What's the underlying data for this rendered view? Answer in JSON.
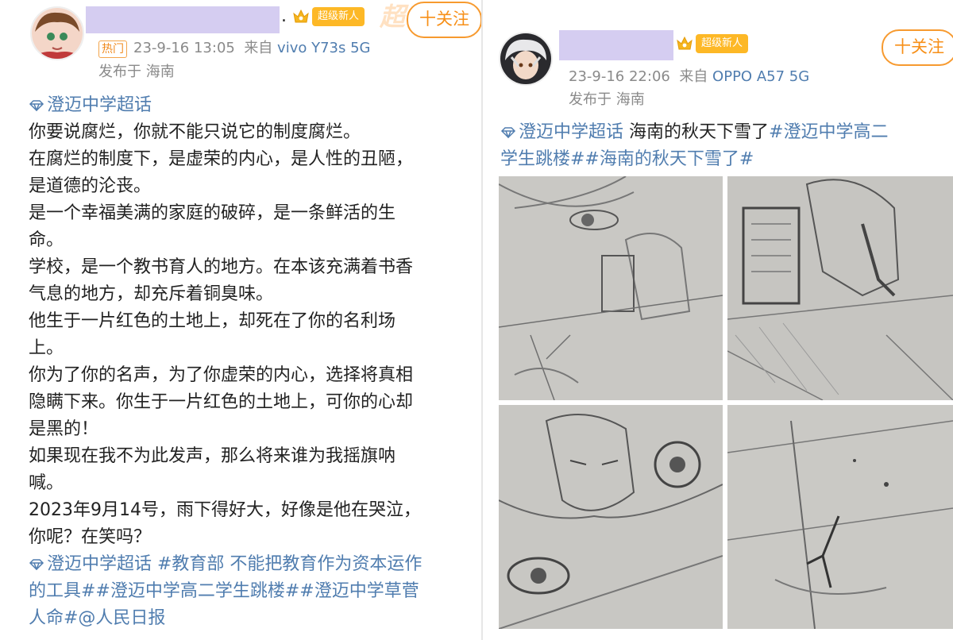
{
  "left_post": {
    "badge": "超级新人",
    "follow_label": "十关注",
    "faded_text": "超",
    "dot": ".",
    "hot_tag": "热门",
    "time": "23-9-16 13:05",
    "source_prefix": "来自",
    "device": "vivo Y73s 5G",
    "location": "发布于 海南",
    "lines": [
      {
        "type": "topic",
        "text": "澄迈中学超话"
      },
      {
        "type": "text",
        "text": "你要说腐烂，你就不能只说它的制度腐烂。"
      },
      {
        "type": "text",
        "text": "在腐烂的制度下，是虚荣的内心，是人性的丑陋，"
      },
      {
        "type": "text",
        "text": "是道德的沦丧。"
      },
      {
        "type": "text",
        "text": "是一个幸福美满的家庭的破碎，是一条鲜活的生"
      },
      {
        "type": "text",
        "text": "命。"
      },
      {
        "type": "text",
        "text": "学校，是一个教书育人的地方。在本该充满着书香"
      },
      {
        "type": "text",
        "text": "气息的地方，却充斥着铜臭味。"
      },
      {
        "type": "text",
        "text": "他生于一片红色的土地上，却死在了你的名利场"
      },
      {
        "type": "text",
        "text": "上。"
      },
      {
        "type": "text",
        "text": "你为了你的名声，为了你虚荣的内心，选择将真相"
      },
      {
        "type": "text",
        "text": "隐瞒下来。你生于一片红色的土地上，可你的心却"
      },
      {
        "type": "text",
        "text": "是黑的！"
      },
      {
        "type": "text",
        "text": "如果现在我不为此发声，那么将来谁为我摇旗呐"
      },
      {
        "type": "text",
        "text": "喊。"
      },
      {
        "type": "text",
        "text": "2023年9月14号，雨下得好大，好像是他在哭泣，"
      },
      {
        "type": "text",
        "text": "你呢？在笑吗？"
      },
      {
        "type": "topic",
        "text": "澄迈中学超话 #教育部 不能把教育作为资本运作"
      },
      {
        "type": "link",
        "text": "的工具##澄迈中学高二学生跳楼##澄迈中学草菅"
      },
      {
        "type": "link",
        "text": "人命#@人民日报"
      }
    ]
  },
  "right_post": {
    "badge": "超级新人",
    "follow_label": "十关注",
    "time": "23-9-16 22:06",
    "source_prefix": "来自",
    "device": "OPPO A57 5G",
    "location": "发布于 海南",
    "line1_topic": "澄迈中学超话",
    "line1_text": " 海南的秋天下雪了",
    "line1_tag": "#澄迈中学高二",
    "line2_tag": "学生跳楼##海南的秋天下雪了#",
    "images": [
      "pencil-sketch-eye-and-boy-with-phone",
      "pencil-sketch-boy-with-phone-closeup",
      "pencil-sketch-face-and-eyes",
      "pencil-sketch-cracked-wall"
    ]
  },
  "colors": {
    "link": "#507daf",
    "follow": "#f78f17",
    "badge": "#fdb826",
    "meta": "#8a8a8a",
    "name_mask": "#d5cdf1"
  }
}
